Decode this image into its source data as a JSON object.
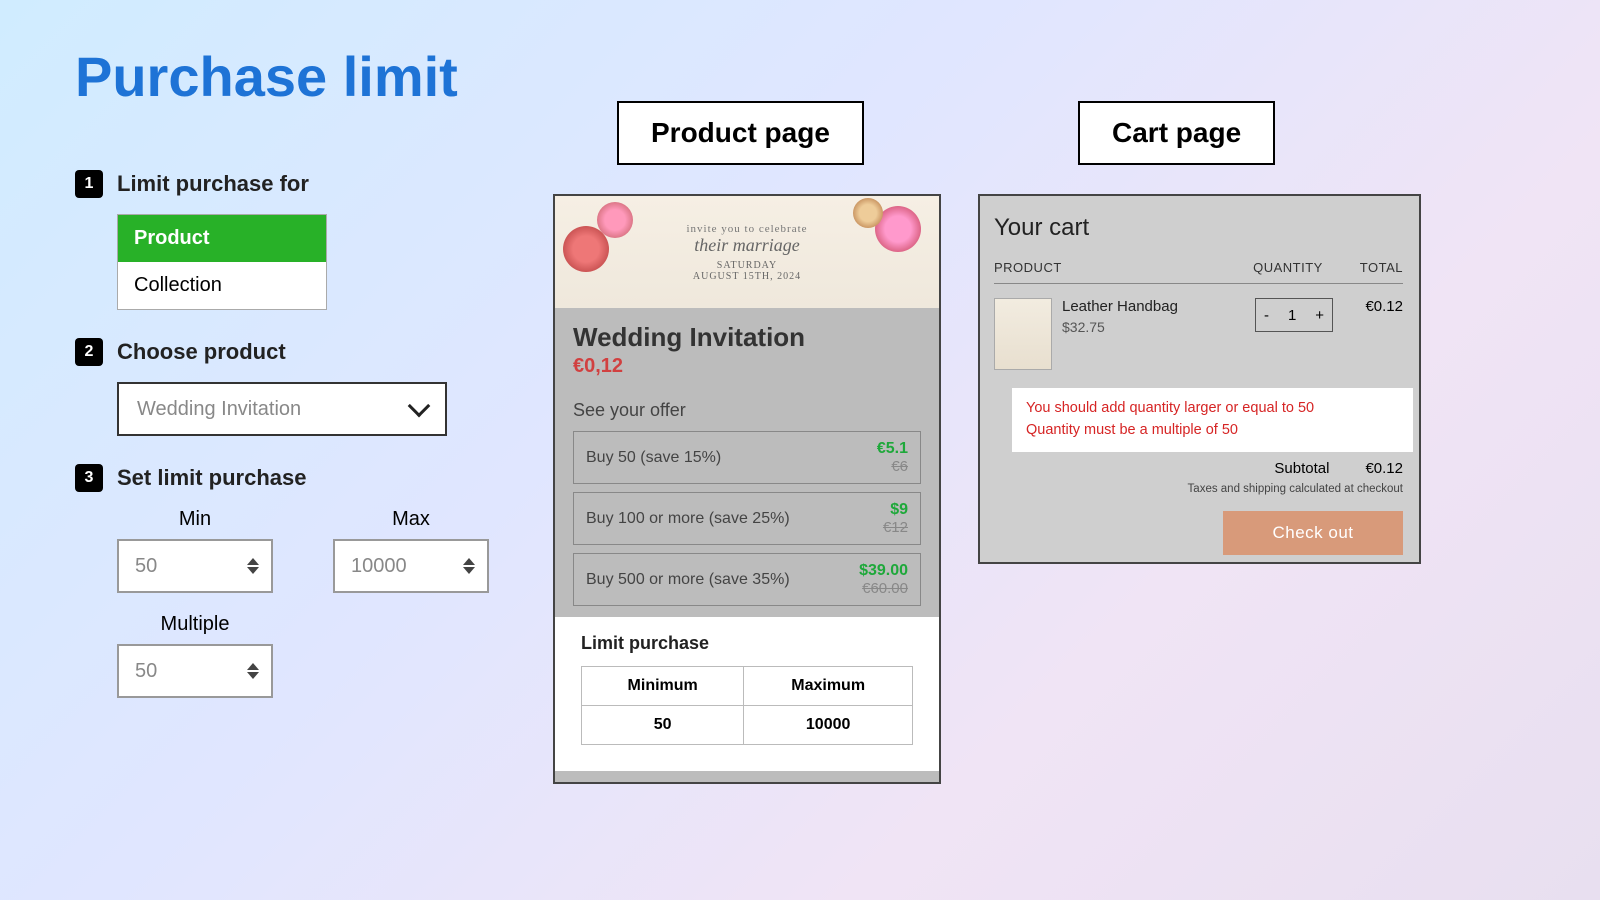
{
  "title": "Purchase limit",
  "steps": {
    "s1": {
      "num": "1",
      "title": "Limit purchase for",
      "options": [
        "Product",
        "Collection"
      ],
      "selected": 0
    },
    "s2": {
      "num": "2",
      "title": "Choose product",
      "value": "Wedding Invitation"
    },
    "s3": {
      "num": "3",
      "title": "Set limit purchase",
      "min_label": "Min",
      "min_value": "50",
      "max_label": "Max",
      "max_value": "10000",
      "multiple_label": "Multiple",
      "multiple_value": "50"
    }
  },
  "labels": {
    "product_page": "Product page",
    "cart_page": "Cart page"
  },
  "product_preview": {
    "hero": {
      "l1": "invite you to celebrate",
      "l2": "their marriage",
      "l3": "SATURDAY",
      "l4": "AUGUST 15TH, 2024"
    },
    "name": "Wedding Invitation",
    "price": "€0,12",
    "offer_title": "See your offer",
    "offers": [
      {
        "text": "Buy 50 (save 15%)",
        "save": "€5.1",
        "orig": "€6"
      },
      {
        "text": "Buy 100 or more (save 25%)",
        "save": "$9",
        "orig": "€12"
      },
      {
        "text": "Buy 500 or more (save 35%)",
        "save": "$39.00",
        "orig": "€60.00"
      }
    ],
    "limit_title": "Limit purchase",
    "limit_headers": [
      "Minimum",
      "Maximum"
    ],
    "limit_values": [
      "50",
      "10000"
    ]
  },
  "cart_preview": {
    "title": "Your cart",
    "head": {
      "product": "PRODUCT",
      "qty": "QUANTITY",
      "total": "TOTAL"
    },
    "item": {
      "name": "Leather Handbag",
      "sub": "$32.75",
      "qty": "1",
      "total": "€0.12"
    },
    "warnings": [
      "You should add quantity larger or equal to 50",
      "Quantity must be a multiple of 50"
    ],
    "subtotal_label": "Subtotal",
    "subtotal_value": "€0.12",
    "taxes": "Taxes and shipping calculated at checkout",
    "checkout": "Check out"
  }
}
